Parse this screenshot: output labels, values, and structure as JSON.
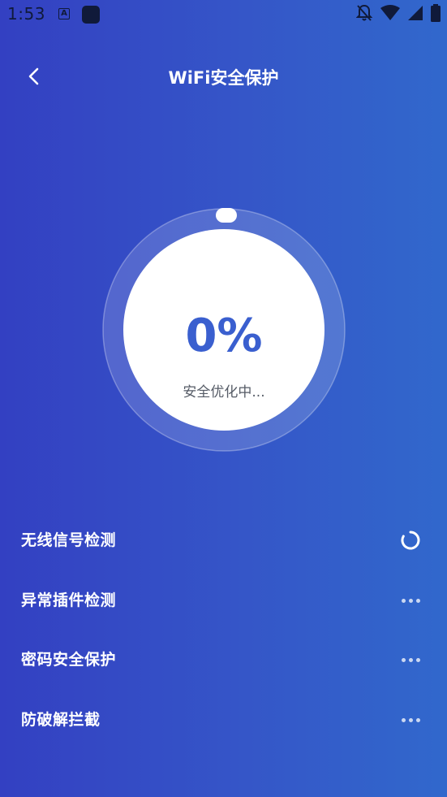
{
  "status_bar": {
    "time": "1:53",
    "app_icon_letter": "A"
  },
  "header": {
    "title": "WiFi安全保护"
  },
  "progress": {
    "percent_text": "0%",
    "percent_value": 0,
    "status_text": "安全优化中..."
  },
  "checks": [
    {
      "label": "无线信号检测",
      "state": "loading"
    },
    {
      "label": "异常插件检测",
      "state": "pending"
    },
    {
      "label": "密码安全保护",
      "state": "pending"
    },
    {
      "label": "防破解拦截",
      "state": "pending"
    }
  ],
  "colors": {
    "bg_start": "#3340c2",
    "bg_end": "#3168cc",
    "accent": "#3a5fcf",
    "status_icon": "#101a3a"
  }
}
